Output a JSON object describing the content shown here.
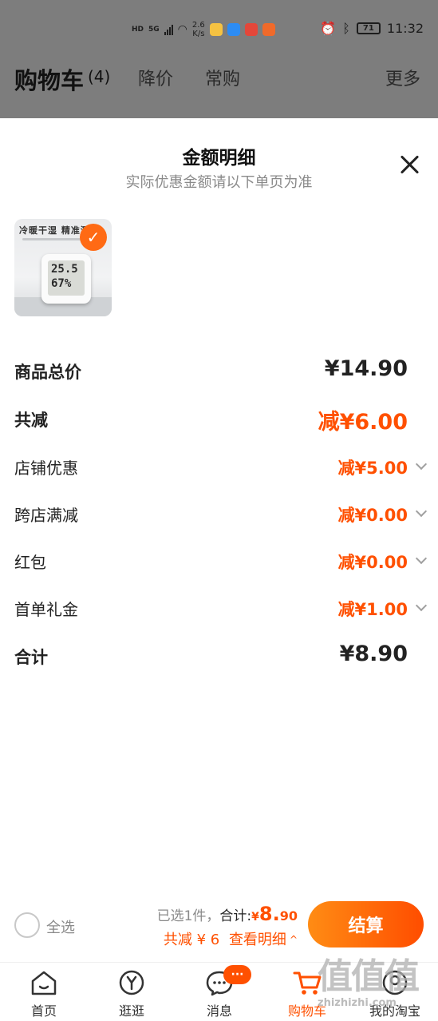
{
  "status_bar": {
    "hd": "HD",
    "net_5g": "5G",
    "net_speed_value": "2.6",
    "net_speed_unit": "K/s",
    "battery": "71",
    "time": "11:32"
  },
  "cart_header": {
    "title": "购物车",
    "count": "(4)",
    "tabs": [
      "降价",
      "常购"
    ],
    "more": "更多"
  },
  "sheet": {
    "title": "金额明细",
    "subtitle": "实际优惠金额请以下单页为准",
    "product_thumb": {
      "caption": "冷暖干湿 精准测",
      "display_top": "25.5",
      "display_bottom": "67%"
    },
    "rows": [
      {
        "label": "商品总价",
        "value": "¥14.90",
        "orange": false
      },
      {
        "label": "共减",
        "value": "减¥6.00",
        "orange": true
      },
      {
        "label": "店铺优惠",
        "value": "减¥5.00",
        "orange": true
      },
      {
        "label": "跨店满减",
        "value": "减¥0.00",
        "orange": true
      },
      {
        "label": "红包",
        "value": "减¥0.00",
        "orange": true
      },
      {
        "label": "首单礼金",
        "value": "减¥1.00",
        "orange": true
      },
      {
        "label": "合计",
        "value": "¥8.90",
        "orange": false
      }
    ]
  },
  "action_bar": {
    "select_all": "全选",
    "selected": "已选1件，",
    "total_label": "合计:",
    "total_currency": "¥",
    "total_int": "8.",
    "total_dec": "90",
    "discount_text": "共减 ¥ 6",
    "view_detail": "查看明细",
    "checkout": "结算"
  },
  "tabbar": {
    "items": [
      "首页",
      "逛逛",
      "消息",
      "购物车",
      "我的淘宝"
    ],
    "message_badge": "···"
  },
  "watermark": {
    "big": "值值值",
    "small": "zhizhizhi.com"
  },
  "colors": {
    "accent": "#ff5000",
    "overlay": "#7d7d7d"
  }
}
